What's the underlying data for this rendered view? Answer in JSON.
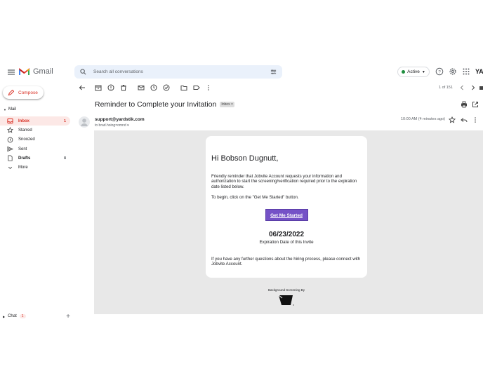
{
  "header": {
    "app_name": "Gmail",
    "search_placeholder": "Search all conversations",
    "status_label": "Active",
    "brand_label": "YA",
    "accent_color": "#d93025"
  },
  "sidebar": {
    "compose_label": "Compose",
    "section_label": "Mail",
    "items": [
      {
        "label": "Inbox",
        "count": "1",
        "icon": "inbox-icon"
      },
      {
        "label": "Starred",
        "count": "",
        "icon": "star-icon"
      },
      {
        "label": "Snoozed",
        "count": "",
        "icon": "clock-icon"
      },
      {
        "label": "Sent",
        "count": "",
        "icon": "send-icon"
      },
      {
        "label": "Drafts",
        "count": "8",
        "icon": "draft-icon"
      },
      {
        "label": "More",
        "count": "",
        "icon": "chevron-down-icon"
      }
    ],
    "chat_label": "Chat",
    "chat_count": "1"
  },
  "toolbar": {
    "pager": "1 of 151"
  },
  "message": {
    "subject": "Reminder to Complete your Invitation",
    "label_chip": "Inbox ×",
    "from": "support@yardstik.com",
    "to": "to brad.hoing=omnd ▾",
    "date": "10:00 AM (4 minutes ago)"
  },
  "email_body": {
    "greeting": "Hi Bobson Dugnutt,",
    "paragraph1": "Friendly reminder that Jobvite Account requests your information and authorization to start the screening/verification required prior to the expiration date listed below.",
    "paragraph2": "To begin, click on the \"Get Me Started\" button.",
    "button_label": "Get Me Started",
    "button_color": "#7552c7",
    "expiration_date": "06/23/2022",
    "expiration_label": "Expiration Date of this Invite",
    "paragraph3": "If you have any further questions about the hiring process, please connect with Jobvite Account.",
    "footer_label": "Background Screening By"
  }
}
